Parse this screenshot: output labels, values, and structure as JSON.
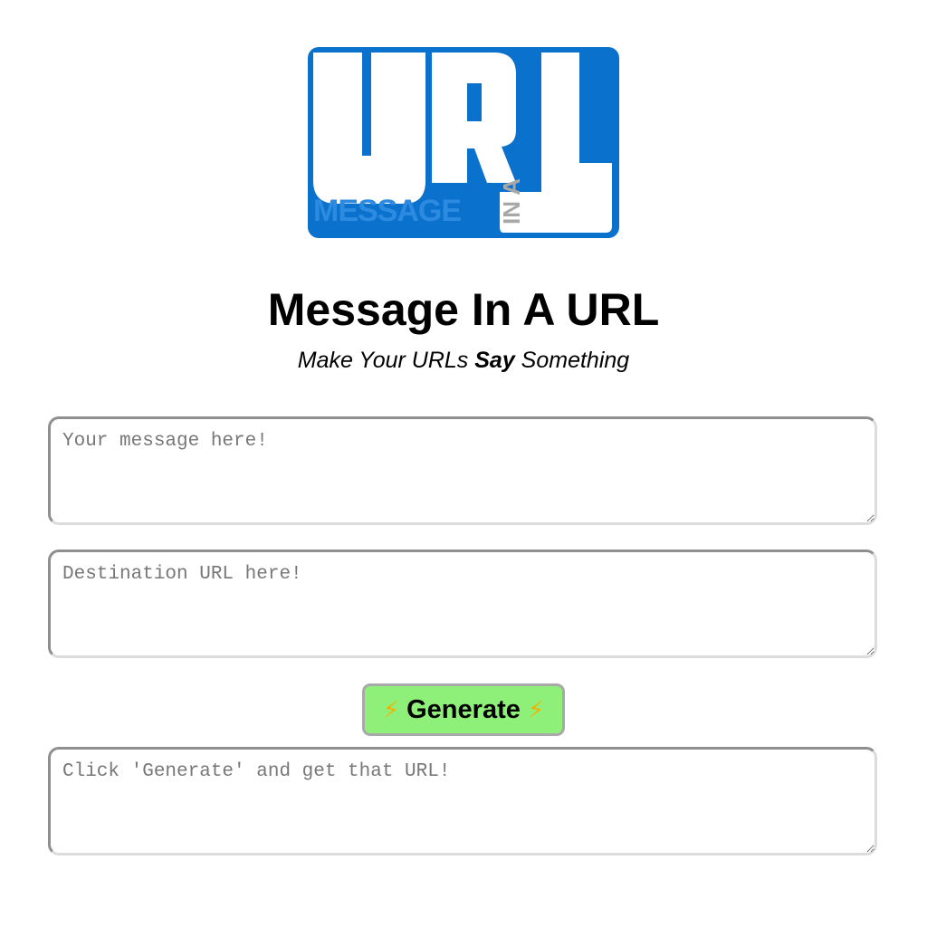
{
  "logo": {
    "big_text": "URL",
    "small_text": "MESSAGE",
    "vertical_text": "IN A",
    "colors": {
      "primary": "#0A72CC",
      "secondary": "#2C8BE0",
      "white": "#FFFFFF",
      "gray": "#A8A8A8"
    }
  },
  "header": {
    "title": "Message In A URL",
    "subtitle_pre": "Make Your URLs ",
    "subtitle_bold": "Say",
    "subtitle_post": " Something"
  },
  "form": {
    "message_placeholder": "Your message here!",
    "destination_placeholder": "Destination URL here!",
    "generate_label": "Generate",
    "generate_icon_left": "⚡",
    "generate_icon_right": "⚡",
    "output_placeholder": "Click 'Generate' and get that URL!"
  },
  "colors": {
    "button_bg": "#8EF078",
    "bolt": "#F5B000"
  }
}
